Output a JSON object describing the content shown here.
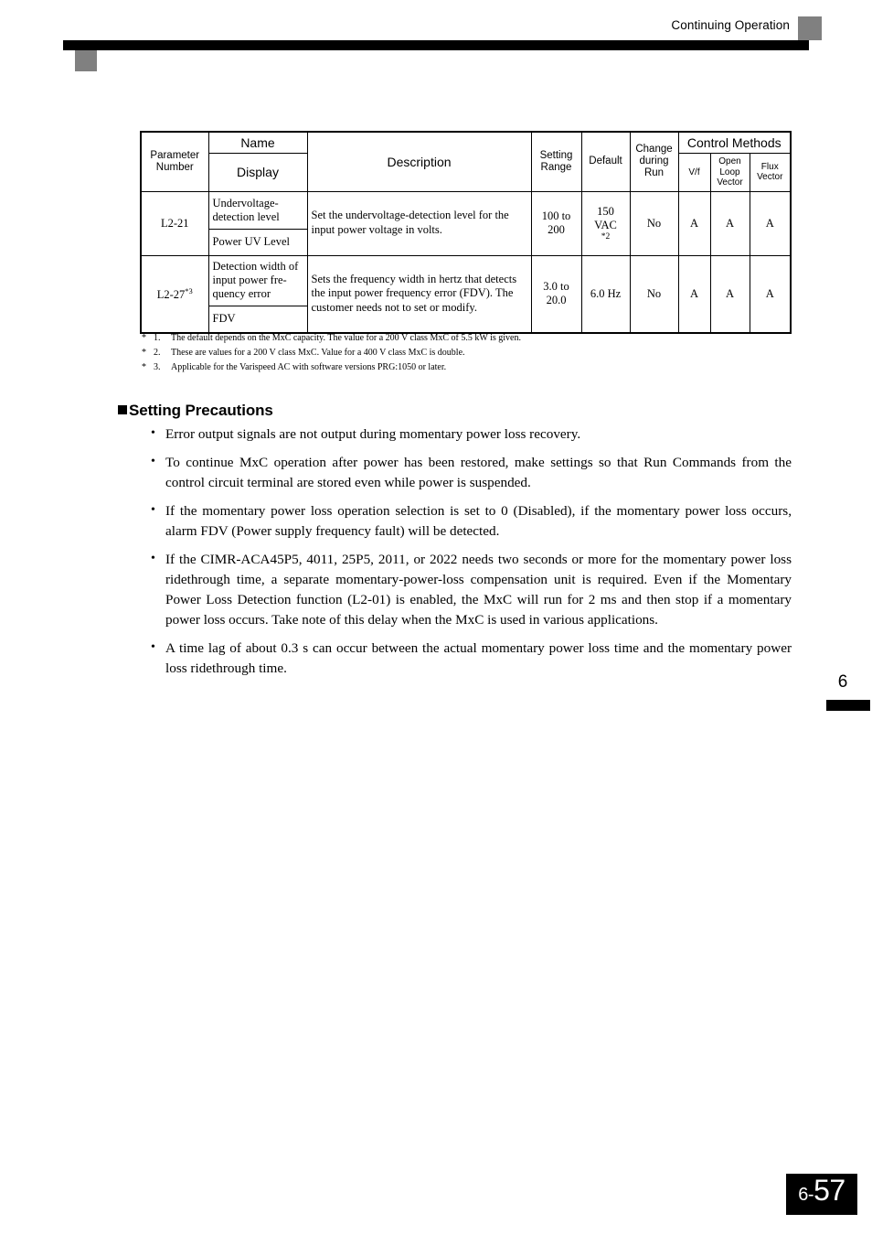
{
  "header": {
    "title": "Continuing Operation"
  },
  "table": {
    "headers": {
      "parameter_number": "Parameter\nNumber",
      "parameter_number_line1": "Parameter",
      "parameter_number_line2": "Number",
      "name": "Name",
      "display": "Display",
      "description": "Description",
      "setting_range_line1": "Setting",
      "setting_range_line2": "Range",
      "default": "Default",
      "change_during_run_line1": "Change",
      "change_during_run_line2": "during",
      "change_during_run_line3": "Run",
      "control_methods": "Control Methods",
      "vf": "V/f",
      "open_loop_vector_line1": "Open",
      "open_loop_vector_line2": "Loop",
      "open_loop_vector_line3": "Vector",
      "flux_vector_line1": "Flux",
      "flux_vector_line2": "Vector"
    },
    "rows": [
      {
        "parameter_number": "L2-21",
        "parameter_number_sup": "",
        "name": "Undervoltage-\ndetection level",
        "name_line1": "Undervoltage-",
        "name_line2": "detection level",
        "display": "Power UV Level",
        "description": "Set the undervoltage-detection level for the input power voltage in volts.",
        "setting_range_line1": "100 to",
        "setting_range_line2": "200",
        "default_line1": "150",
        "default_line2": "VAC",
        "default_line3": "*2",
        "change_during_run": "No",
        "vf": "A",
        "open_loop_vector": "A",
        "flux_vector": "A"
      },
      {
        "parameter_number": "L2-27",
        "parameter_number_sup": "*3",
        "name": "Detection width of\ninput power fre-\nquency error",
        "name_line1": "Detection width of",
        "name_line2": "input power fre-",
        "name_line3": "quency error",
        "display": "FDV",
        "description": "Sets the frequency width in hertz that detects the input power frequency error (FDV). The customer needs not to set or modify.",
        "setting_range_line1": "3.0 to",
        "setting_range_line2": "20.0",
        "default_line1": "6.0 Hz",
        "default_line2": "",
        "default_line3": "",
        "change_during_run": "No",
        "vf": "A",
        "open_loop_vector": "A",
        "flux_vector": "A"
      }
    ]
  },
  "footnotes": [
    {
      "star": "*",
      "num": "1.",
      "text": "The default depends on the MxC capacity. The value for a 200 V class MxC of 5.5 kW is given."
    },
    {
      "star": "*",
      "num": "2.",
      "text": "These are values for a 200 V class MxC. Value for a 400 V class MxC is double."
    },
    {
      "star": "*",
      "num": "3.",
      "text": "Applicable for the Varispeed AC with software versions PRG:1050 or later."
    }
  ],
  "section": {
    "heading": "Setting Precautions"
  },
  "bullets": [
    {
      "dot": "•",
      "text": "Error output signals are not output during momentary power loss recovery."
    },
    {
      "dot": "•",
      "text": "To continue MxC operation after power has been restored, make settings so that Run Commands from the control circuit terminal are stored even while power is suspended."
    },
    {
      "dot": "•",
      "text": "If the momentary power loss operation selection is set to 0 (Disabled), if the momentary power loss occurs, alarm FDV (Power supply frequency fault) will be detected."
    },
    {
      "dot": "•",
      "text": "If the CIMR-ACA45P5, 4011, 25P5, 2011, or 2022 needs two seconds or more for the momentary power loss ridethrough time, a separate momentary-power-loss compensation unit is required. Even if the Momentary Power Loss Detection function (L2-01) is enabled, the MxC will run for 2 ms and then stop if a momentary power loss occurs. Take note of this delay when the MxC is used in various applications."
    },
    {
      "dot": "•",
      "text": "A time lag of about 0.3 s can occur between the actual momentary power loss time and the momentary power loss ridethrough time."
    }
  ],
  "chapter": {
    "number": "6"
  },
  "footer": {
    "page_chapter": "6-",
    "page_number": "57"
  }
}
